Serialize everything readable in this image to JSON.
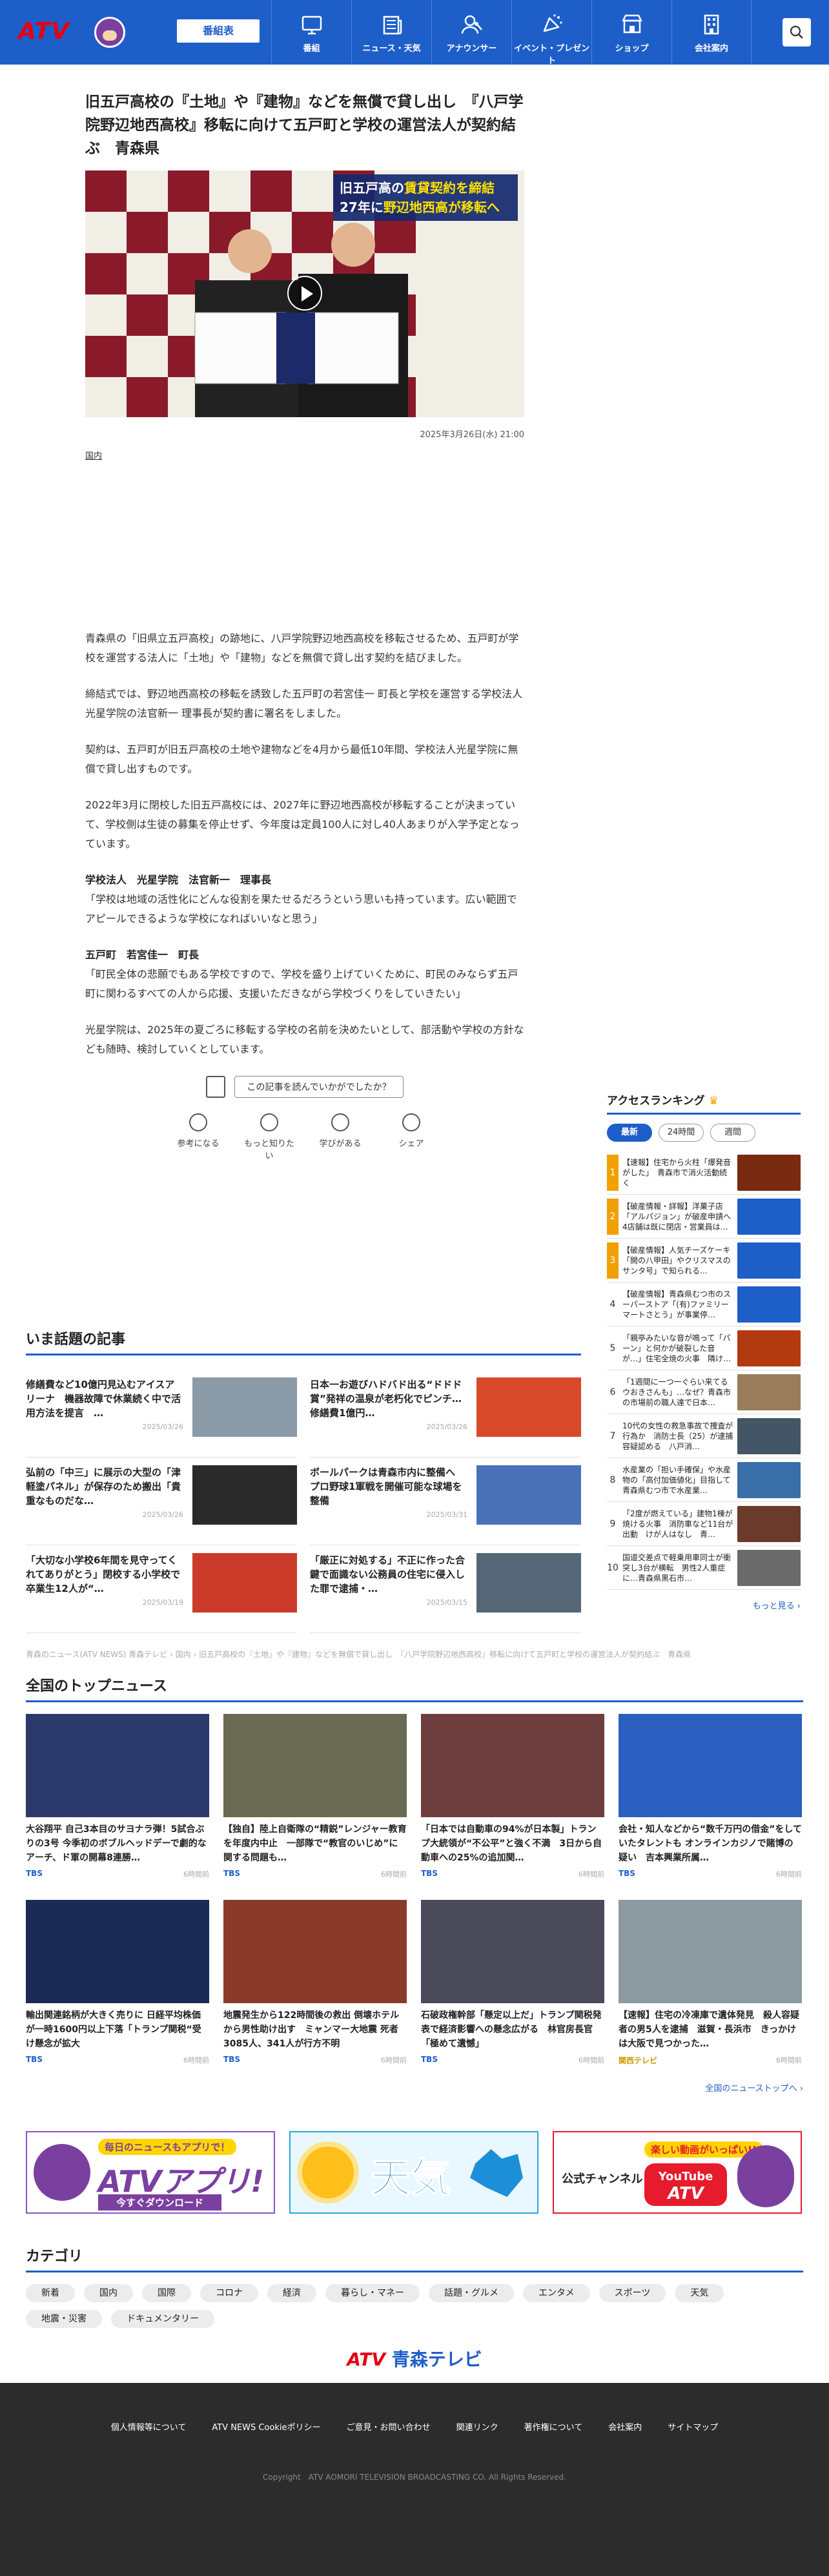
{
  "header": {
    "logo_text": "ATV",
    "tv_schedule_label": "番組表",
    "nav": [
      {
        "label": "番組",
        "icon": "tv-icon"
      },
      {
        "label": "ニュース・天気",
        "icon": "newspaper-icon"
      },
      {
        "label": "アナウンサー",
        "icon": "announcer-icon"
      },
      {
        "label": "イベント・プレゼント",
        "icon": "event-icon"
      },
      {
        "label": "ショップ",
        "icon": "shop-icon"
      },
      {
        "label": "会社案内",
        "icon": "building-icon"
      }
    ]
  },
  "article": {
    "title": "旧五戸高校の『土地』や『建物』などを無償で貸し出し　『八戸学院野辺地西高校』移転に向けて五戸町と学校の運営法人が契約結ぶ　青森県",
    "hero_caption_line1a": "旧五戸高の",
    "hero_caption_line1b": "賃貸契約を締結",
    "hero_caption_line2a": "27年に",
    "hero_caption_line2b": "野辺地西高が移転へ",
    "date": "2025年3月26日(水) 21:00",
    "category": "国内",
    "paragraphs": [
      "青森県の「旧県立五戸高校」の跡地に、八戸学院野辺地西高校を移転させるため、五戸町が学校を運営する法人に「土地」や「建物」などを無償で貸し出す契約を結びました。",
      "締結式では、野辺地西高校の移転を誘致した五戸町の若宮佳一 町長と学校を運営する学校法人光星学院の法官新一 理事長が契約書に署名をしました。",
      "契約は、五戸町が旧五戸高校の土地や建物などを4月から最低10年間、学校法人光星学院に無償で貸し出すものです。",
      "2022年3月に閉校した旧五戸高校には、2027年に野辺地西高校が移転することが決まっていて、学校側は生徒の募集を停止せず、今年度は定員100人に対し40人あまりが入学予定となっています。"
    ],
    "speaker1": "学校法人　光星学院　法官新一　理事長",
    "quote1": "「学校は地域の活性化にどんな役割を果たせるだろうという思いも持っています。広い範囲でアピールできるような学校になればいいなと思う」",
    "speaker2": "五戸町　若宮佳一　町長",
    "quote2": "「町民全体の悲願でもある学校ですので、学校を盛り上げていくために、町民のみならず五戸町に関わるすべての人から応援、支援いただきながら学校づくりをしていきたい」",
    "closing": "光星学院は、2025年の夏ごろに移転する学校の名前を決めたいとして、部活動や学校の方針なども随時、検討していくとしています。",
    "feedback_question": "この記事を読んでいかがでしたか？",
    "feedback_options": [
      "参考になる",
      "もっと知りたい",
      "学びがある",
      "シェア"
    ]
  },
  "ranking": {
    "title": "アクセスランキング",
    "tabs": [
      "最新",
      "24時間",
      "週間"
    ],
    "items": [
      {
        "rank": "1",
        "text": "【速報】住宅から火柱「爆発音がした」　青森市で消火活動続く",
        "color": "#7a2a10"
      },
      {
        "rank": "2",
        "text": "【破産情報・詳報】洋菓子店「アルパジョン」が破産申請へ　4店舗は既に閉店・営業員は…",
        "color": "#1e5ec8"
      },
      {
        "rank": "3",
        "text": "【破産情報】人気チーズケーキ「開の八甲田」やクリスマスのサンタ号」で知られる…",
        "color": "#1e5ec8"
      },
      {
        "rank": "4",
        "text": "【破産情報】青森県むつ市のスーパーストア「(有)ファミリーマートさとう」が事業停…",
        "color": "#1e5ec8"
      },
      {
        "rank": "5",
        "text": "「親亭みたいな音が鳴って「パーン」と何かが破裂した音が…」住宅全焼の火事　隣け…",
        "color": "#b33a10"
      },
      {
        "rank": "6",
        "text": "「1週間に一つ一ぐらい来てるウおきさんも」…なぜ？青森市の市場前の職人達で日本…",
        "color": "#9a7b5a"
      },
      {
        "rank": "7",
        "text": "10代の女性の救急事故で捜査が行為か　消防士長（25）が逮捕　容疑認める　八戸消…",
        "color": "#445566"
      },
      {
        "rank": "8",
        "text": "水産業の「担い手確保」や水産物の「高付加価値化」目指して　青森県むつ市で水産業…",
        "color": "#3a6ea8"
      },
      {
        "rank": "9",
        "text": "「2度が燃えている」建物1棟が焼ける火事　消防車など11台が出動　けが人はなし　青…",
        "color": "#6b3a2a"
      },
      {
        "rank": "10",
        "text": "国道交差点で軽乗用車同士が衝突し3台が横転　男性2人重症に…青森県黒石市…",
        "color": "#6a6a6a"
      }
    ],
    "more": "もっと見る ›"
  },
  "trending": {
    "title": "いま話題の記事",
    "items": [
      {
        "title": "修繕費など10億円見込むアイスアリーナ　機器故障で休業続く中で活用方法を提言　…",
        "date": "2025/03/26",
        "color": "#8a9aa6"
      },
      {
        "title": "日本一お遊びハドバド出る“ドドド賞”発祥の温泉が老朽化でピンチ…修繕費1億円…",
        "date": "2025/03/26",
        "color": "#d84a2a"
      },
      {
        "title": "弘前の「中三」に展示の大型の「津軽塗パネル」が保存のため搬出「貴重なものだな…",
        "date": "2025/03/26",
        "color": "#2a2a2a"
      },
      {
        "title": "ボールパークは青森市内に整備へ　プロ野球1軍戦を開催可能な球場を整備",
        "date": "2025/03/31",
        "color": "#4a72b8"
      },
      {
        "title": "「大切な小学校6年間を見守ってくれてありがとう」閉校する小学校で卒業生12人が“…",
        "date": "2025/03/19",
        "color": "#cc3a2a"
      },
      {
        "title": "「厳正に対処する」不正に作った合鍵で面識ない公務員の住宅に侵入した罪で逮捕・…",
        "date": "2025/03/15",
        "color": "#556677"
      }
    ]
  },
  "breadcrumb": "青森のニュース(ATV NEWS) 青森テレビ ›  国内 ›  旧五戸高校の『土地』や『建物』などを無償で貸し出し　『八戸学院野辺地西高校』移転に向けて五戸町と学校の運営法人が契約結ぶ　青森県",
  "national": {
    "title": "全国のトップニュース",
    "items": [
      {
        "title": "大谷翔平 自己3本目のサヨナラ弾！5試合ぶりの3号 今季初のボブルヘッドデーで劇的なアーチ、ド軍の開幕8連勝…",
        "src": "TBS",
        "ago": "6時間前",
        "color": "#2b3a6a"
      },
      {
        "title": "【独自】陸上自衛隊の“精鋭”レンジャー教育を年度内中止　一部隊で“教官のいじめ”に関する問題も…",
        "src": "TBS",
        "ago": "6時間前",
        "color": "#6a6a52"
      },
      {
        "title": "「日本では自動車の94%が日本製」トランプ大統領が“不公平”と強く不満　3日から自動車への25%の追加関…",
        "src": "TBS",
        "ago": "6時間前",
        "color": "#6e3d3d"
      },
      {
        "title": "会社・知人などから“数千万円の借金”をしていたタレントも オンラインカジノで賭博の疑い　吉本興業所属…",
        "src": "TBS",
        "ago": "6時間前",
        "color": "#2a5fc0"
      },
      {
        "title": "輸出関連銘柄が大きく売りに 日経平均株価が一時1600円以上下落「トランプ関税“受け懸念が拡大",
        "src": "TBS",
        "ago": "6時間前",
        "color": "#1b2a55"
      },
      {
        "title": "地震発生から122時間後の救出 倒壊ホテルから男性助け出す　ミャンマー大地震 死者3085人、341人が行方不明",
        "src": "TBS",
        "ago": "6時間前",
        "color": "#8a3a2a"
      },
      {
        "title": "石破政権幹部「懸定以上だ」トランプ関税発表で経済影響への懸念広がる　林官房長官「極めて遺憾」",
        "src": "TBS",
        "ago": "6時間前",
        "color": "#4a4a5a"
      },
      {
        "title": "【速報】住宅の冷凍庫で遺体発見　殺人容疑者の男5人を逮捕　滋賀・長浜市　きっかけは大阪で見つかった…",
        "src": "関西テレビ",
        "ago": "6時間前",
        "color": "#8a9aa0"
      }
    ],
    "more": "全国のニューストップへ ›"
  },
  "banners": {
    "app_top": "毎日のニュースもアプリで！",
    "app_main": "ATVアプリ!",
    "app_sub": "今すぐダウンロード",
    "weather": "天気",
    "yt_top": "楽しい動画がいっぱい!!",
    "yt_left": "公式チャンネル",
    "yt_logo1": "YouTube",
    "yt_logo2": "ATV"
  },
  "categories": {
    "title": "カテゴリ",
    "items": [
      "新着",
      "国内",
      "国際",
      "コロナ",
      "経済",
      "暮らし・マネー",
      "話題・グルメ",
      "エンタメ",
      "スポーツ",
      "天気",
      "地震・災害",
      "ドキュメンタリー"
    ]
  },
  "footer": {
    "logo_text": "ATV",
    "logo_jp": "青森テレビ",
    "links": [
      "個人情報等について",
      "ATV NEWS Cookieポリシー",
      "ご意見・お問い合わせ",
      "関連リンク",
      "著作権について",
      "会社案内",
      "サイトマップ"
    ],
    "copyright": "Copyright　ATV AOMORI TELEVISION BROADCASTING CO. All Rights Reserved."
  },
  "colors": {
    "brand_blue": "#1e5ec8",
    "brand_red": "#e50012",
    "accent_gold": "#f0a000"
  }
}
